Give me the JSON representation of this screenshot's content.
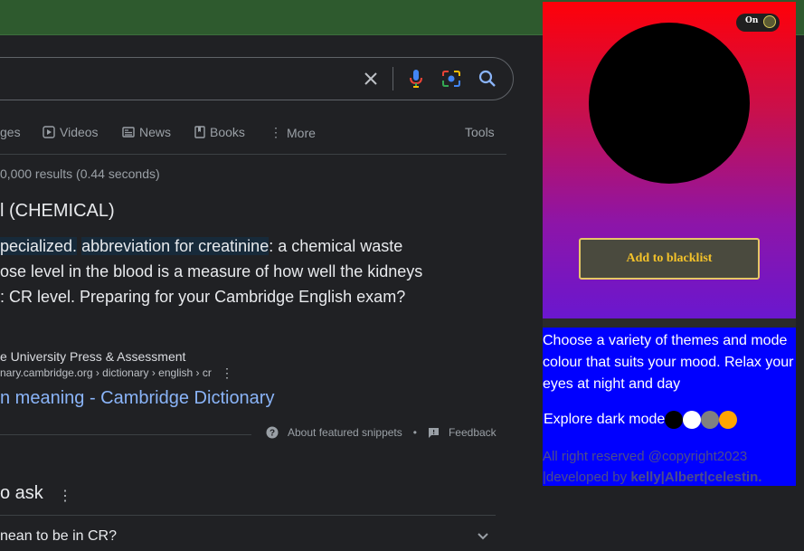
{
  "search": {
    "clear_icon": "close-icon",
    "voice_icon": "microphone-icon",
    "lens_icon": "camera-lens-icon",
    "search_icon": "search-icon"
  },
  "tabs": {
    "images": "ges",
    "videos": "Videos",
    "news": "News",
    "books": "Books",
    "more": "More",
    "tools": "Tools"
  },
  "results": {
    "stats": "0,000 results (0.44 seconds)",
    "heading": "l (CHEMICAL)",
    "snippet_hl1": "pecialized.",
    "snippet_hl2": "abbreviation for creatinine",
    "snippet_rest1": ": a chemical waste",
    "snippet_line2": "ose level in the blood is a measure of how well the kidneys",
    "snippet_line3": ": CR level. Preparing for your Cambridge English exam?",
    "source_name": "e University Press & Assessment",
    "source_url": "nary.cambridge.org › dictionary › english › cr",
    "link_text": "n meaning - Cambridge Dictionary",
    "about_snippets": "About featured snippets",
    "bullet": "•",
    "feedback": "Feedback",
    "paa_title": "o ask",
    "paa_question": "nean to be in CR?"
  },
  "popup": {
    "toggle_label": "On",
    "blacklist_button": "Add to blacklist",
    "description": "Choose a variety of themes and mode colour that suits your mood. Relax your eyes at night and day",
    "explore_label": "Explore dark mode",
    "copyright": "All right reserved @copyright2023",
    "developed_prefix": "|developed by ",
    "developers": "kelly|Albert|celestin.",
    "theme_colors": [
      "#000000",
      "#ffffff",
      "#808080",
      "#ffa500"
    ],
    "gradient_colors": [
      "#ff0008",
      "#6a17cf"
    ],
    "accent_color": "#f3c22a"
  }
}
